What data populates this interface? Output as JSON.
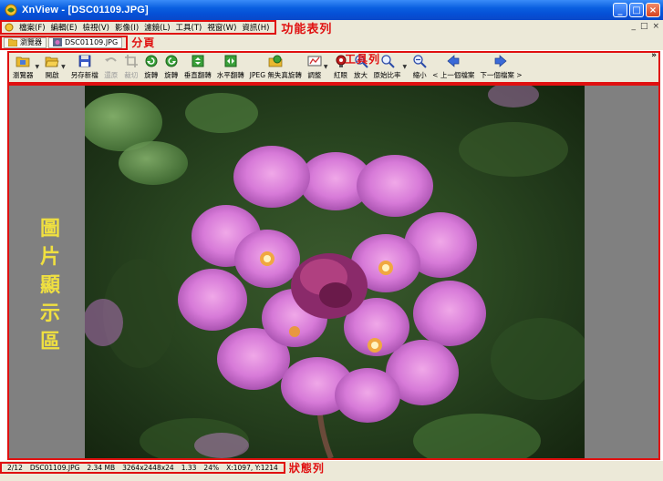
{
  "window": {
    "title": "XnView - [DSC01109.JPG]",
    "minimize": "_",
    "maximize": "□",
    "close": "×"
  },
  "menubar": {
    "items": [
      "檔案(F)",
      "編輯(E)",
      "檢視(V)",
      "影像(I)",
      "濾鏡(L)",
      "工具(T)",
      "視窗(W)",
      "資訊(H)"
    ],
    "annotation": "功能表列",
    "mdi_buttons": [
      "_",
      "□",
      "×"
    ]
  },
  "tabs": {
    "items": [
      {
        "label": "瀏覽器",
        "icon": "browser-folder-icon"
      },
      {
        "label": "DSC01109.JPG",
        "icon": "image-thumbnail-icon"
      }
    ],
    "annotation": "分頁"
  },
  "toolbar": {
    "annotation": "工具列",
    "more": "»",
    "buttons": [
      {
        "label": "瀏覽器",
        "icon": "browser-icon",
        "dropdown": true,
        "enabled": true
      },
      {
        "label": "開啟",
        "icon": "open-folder-icon",
        "dropdown": true,
        "enabled": true
      },
      {
        "label": "另存新檔",
        "icon": "save-disk-icon",
        "dropdown": false,
        "enabled": true
      },
      {
        "label": "還原",
        "icon": "undo-icon",
        "dropdown": false,
        "enabled": false
      },
      {
        "label": "裁切",
        "icon": "crop-icon",
        "dropdown": false,
        "enabled": false
      },
      {
        "label": "旋轉",
        "icon": "rotate-left-icon",
        "dropdown": false,
        "enabled": true
      },
      {
        "label": "旋轉",
        "icon": "rotate-right-icon",
        "dropdown": false,
        "enabled": true
      },
      {
        "label": "垂直翻轉",
        "icon": "flip-vertical-icon",
        "dropdown": false,
        "enabled": true
      },
      {
        "label": "水平翻轉",
        "icon": "flip-horizontal-icon",
        "dropdown": false,
        "enabled": true
      },
      {
        "label": "JPEG 無失真旋轉",
        "icon": "jpeg-lossless-rotate-icon",
        "dropdown": false,
        "enabled": true
      },
      {
        "label": "調整",
        "icon": "adjust-icon",
        "dropdown": true,
        "enabled": true
      },
      {
        "label": "紅眼",
        "icon": "red-eye-icon",
        "dropdown": false,
        "enabled": true
      },
      {
        "label": "放大",
        "icon": "zoom-in-icon",
        "dropdown": false,
        "enabled": true
      },
      {
        "label": "原始比率",
        "icon": "zoom-original-icon",
        "dropdown": true,
        "enabled": true
      },
      {
        "label": "縮小",
        "icon": "zoom-out-icon",
        "dropdown": false,
        "enabled": true
      },
      {
        "label": "< 上一個檔案",
        "icon": "previous-file-icon",
        "dropdown": false,
        "enabled": true
      },
      {
        "label": "下一個檔案 >",
        "icon": "next-file-icon",
        "dropdown": false,
        "enabled": true
      }
    ]
  },
  "viewer": {
    "annotation_chars": [
      "圖",
      "片",
      "顯",
      "示",
      "區"
    ]
  },
  "statusbar": {
    "fields": [
      "2/12",
      "DSC01109.JPG",
      "2.34 MB",
      "3264x2448x24",
      "1.33",
      "24%",
      "X:1097, Y:1214"
    ],
    "annotation": "狀態列"
  },
  "colors": {
    "annotation_red": "#e01010",
    "annotation_yellow": "#f0e040",
    "title_blue": "#0a5fe0",
    "chrome": "#ece9d8"
  }
}
